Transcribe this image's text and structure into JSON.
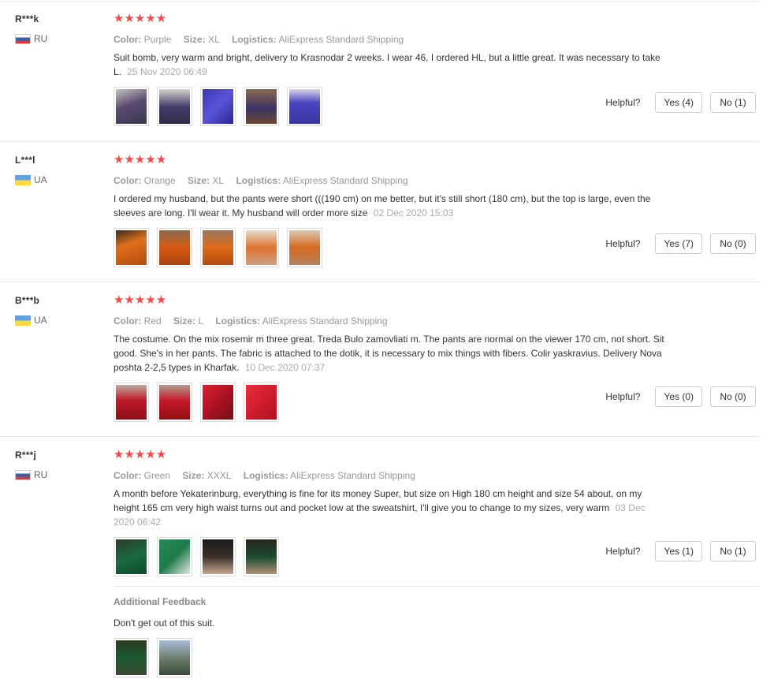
{
  "helpful_label": "Helpful?",
  "colors": {
    "star": "#f04a4a",
    "border": "#e8e8e8"
  },
  "labels": {
    "color": "Color:",
    "size": "Size:",
    "logistics": "Logistics:"
  },
  "reviews": [
    {
      "user": "R***k",
      "country": "RU",
      "stars": "★★★★★",
      "color": "Purple",
      "size": "XL",
      "logistics": "AliExpress Standard Shipping",
      "text": "Suit bomb, very warm and bright, delivery to Krasnodar 2 weeks. I wear 46, I ordered HL, but a little great. It was necessary to take L.",
      "date": "25 Nov 2020 06:49",
      "yes": "Yes (4)",
      "no": "No (1)",
      "thumb_count": 5
    },
    {
      "user": "L***l",
      "country": "UA",
      "stars": "★★★★★",
      "color": "Orange",
      "size": "XL",
      "logistics": "AliExpress Standard Shipping",
      "text": "I ordered my husband, but the pants were short (((190 cm) on me better, but it's still short (180 cm), but the top is large, even the sleeves are long. I'll wear it. My husband will order more size",
      "date": "02 Dec 2020 15:03",
      "yes": "Yes (7)",
      "no": "No (0)",
      "thumb_count": 5
    },
    {
      "user": "B***b",
      "country": "UA",
      "stars": "★★★★★",
      "color": "Red",
      "size": "L",
      "logistics": "AliExpress Standard Shipping",
      "text": "The costume. On the mix rosemir m three great. Treda Bulo zamovliati m. The pants are normal on the viewer 170 cm, not short. Sit good. She's in her pants. The fabric is attached to the dotik, it is necessary to mix things with fibers. Colir yaskravius. Delivery Nova poshta 2-2,5 types in Kharfak.",
      "date": "10 Dec 2020 07:37",
      "yes": "Yes (0)",
      "no": "No (0)",
      "thumb_count": 4
    },
    {
      "user": "R***j",
      "country": "RU",
      "stars": "★★★★★",
      "color": "Green",
      "size": "XXXL",
      "logistics": "AliExpress Standard Shipping",
      "text": "A month before Yekaterinburg, everything is fine for its money Super, but size on High 180 cm height and size 54 about, on my height 165 cm very high waist turns out and pocket low at the sweatshirt, I'll give you to change to my sizes, very warm",
      "date": "03 Dec 2020 06:42",
      "yes": "Yes (1)",
      "no": "No (1)",
      "thumb_count": 4
    }
  ],
  "additional_feedback": {
    "title": "Additional Feedback",
    "text": "Don't get out of this suit."
  }
}
